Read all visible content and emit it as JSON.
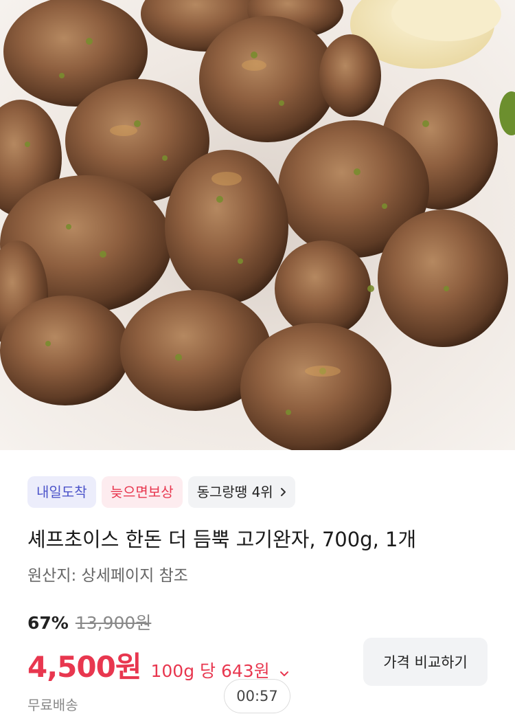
{
  "product_image": {
    "alt": "meatballs-photo"
  },
  "badges": {
    "arrival": "내일도착",
    "compensation": "늦으면보상",
    "rank": "동그랑땡 4위"
  },
  "product": {
    "title": "셰프초이스 한돈 더 듬뿍 고기완자, 700g, 1개",
    "origin": "원산지: 상세페이지 참조"
  },
  "pricing": {
    "discount_rate": "67%",
    "original_price": "13,900원",
    "price": "4,500원",
    "unit_price": "100g 당 643원",
    "compare_button": "가격 비교하기"
  },
  "shipping": "무료배송",
  "timer": "00:57",
  "colors": {
    "accent_red": "#e8374f",
    "arrival_blue": "#4b53c9",
    "arrival_bg": "#ecedfb",
    "comp_bg": "#fdecef",
    "neutral_bg": "#f2f3f5"
  }
}
